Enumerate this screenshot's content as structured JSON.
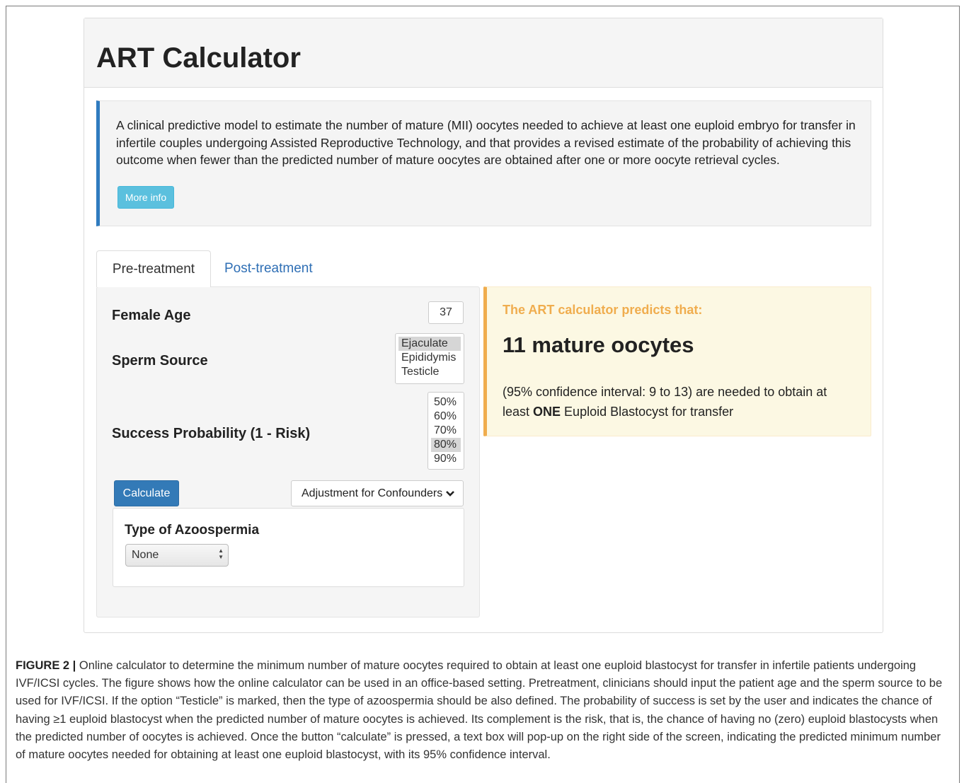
{
  "app": {
    "title": "ART Calculator",
    "description": "A clinical predictive model to estimate the number of mature (MII) oocytes needed to achieve at least one euploid embryo for transfer in infertile couples undergoing Assisted Reproductive Technology, and that provides a revised estimate of the probability of achieving this outcome when fewer than the predicted number of mature oocytes are obtained after one or more oocyte retrieval cycles.",
    "more_info_label": "More info"
  },
  "tabs": [
    {
      "label": "Pre-treatment",
      "active": true
    },
    {
      "label": "Post-treatment",
      "active": false
    }
  ],
  "form": {
    "female_age_label": "Female Age",
    "female_age_value": "37",
    "sperm_source_label": "Sperm Source",
    "sperm_source_options": [
      "Ejaculate",
      "Epididymis",
      "Testicle"
    ],
    "sperm_source_selected": "Ejaculate",
    "success_probability_label": "Success Probability (1 - Risk)",
    "success_probability_options": [
      "50%",
      "60%",
      "70%",
      "80%",
      "90%"
    ],
    "success_probability_selected": "80%",
    "calculate_label": "Calculate",
    "adjustment_label": "Adjustment for Confounders",
    "azoospermia_label": "Type of Azoospermia",
    "azoospermia_value": "None"
  },
  "result": {
    "heading": "The ART calculator predicts that:",
    "number": "11 mature oocytes",
    "text_part1": "(95% confidence interval: 9 to 13) are needed to obtain at least ",
    "text_bold": "ONE",
    "text_part2": " Euploid Blastocyst for transfer"
  },
  "caption": {
    "figure_label": "FIGURE 2 |",
    "text": " Online calculator to determine the minimum number of mature oocytes required to obtain at least one euploid blastocyst for transfer in infertile patients undergoing IVF/ICSI cycles. The figure shows how the online calculator can be used in an office-based setting. Pretreatment, clinicians should input the patient age and the sperm source to be used for IVF/ICSI. If the option “Testicle” is marked, then the type of azoospermia should be also defined. The probability of success is set by the user and indicates the chance of having ≥1 euploid blastocyst when the predicted number of mature oocytes is achieved. Its complement is the risk, that is, the chance of having no (zero) euploid blastocysts when the predicted number of oocytes is achieved. Once the button “calculate” is pressed, a text box will pop-up on the right side of the screen, indicating the predicted minimum number of mature oocytes needed for obtaining at least one euploid blastocyst, with its 95% confidence interval."
  },
  "colors": {
    "primary": "#337ab7",
    "info": "#5bc0de",
    "warning": "#f0ad4e",
    "warning_bg": "#fcf8e3"
  }
}
